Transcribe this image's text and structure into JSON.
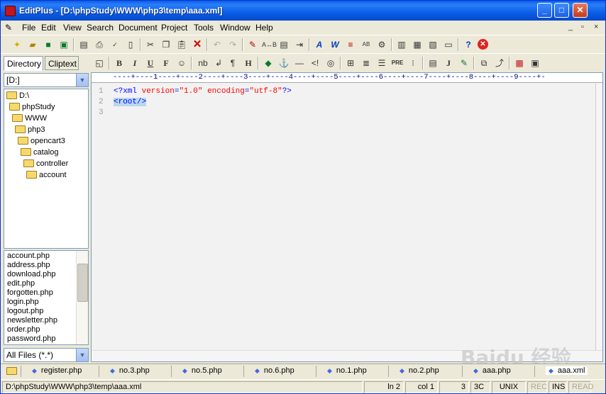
{
  "window": {
    "title": "EditPlus - [D:\\phpStudy\\WWW\\php3\\temp\\aaa.xml]",
    "minimize": "_",
    "maximize": "□",
    "close": "✕"
  },
  "menu": [
    "File",
    "Edit",
    "View",
    "Search",
    "Document",
    "Project",
    "Tools",
    "Window",
    "Help"
  ],
  "mdi_controls": [
    "_",
    "▫",
    "×"
  ],
  "left_panel": {
    "tabs": [
      "Directory",
      "Cliptext"
    ],
    "drive": "[D:]",
    "tree": [
      "D:\\",
      "phpStudy",
      "WWW",
      "php3",
      "opencart3",
      "catalog",
      "controller",
      "account"
    ],
    "files": [
      "account.php",
      "address.php",
      "download.php",
      "edit.php",
      "forgotten.php",
      "login.php",
      "logout.php",
      "newsletter.php",
      "order.php",
      "password.php"
    ],
    "filter": "All Files (*.*)"
  },
  "editor": {
    "ruler": "----+----1----+----2----+----3----+----4----+----5----+----6----+----7----+----8----+----9----+-",
    "line_numbers": [
      "1",
      "2",
      "3"
    ],
    "lines": {
      "l1_open": "<?xml ",
      "l1_attr1": "version",
      "l1_eq1": "=",
      "l1_val1": "\"1.0\"",
      "l1_sp": " ",
      "l1_attr2": "encoding",
      "l1_eq2": "=",
      "l1_val2": "\"utf-8\"",
      "l1_close": "?>",
      "l2": "<root/>"
    }
  },
  "file_tabs": [
    "register.php",
    "no.3.php",
    "no.5.php",
    "no.6.php",
    "no.1.php",
    "no.2.php",
    "aaa.php",
    "aaa.xml"
  ],
  "status": {
    "path": "D:\\phpStudy\\WWW\\php3\\temp\\aaa.xml",
    "line": "ln 2",
    "col": "col 1",
    "num": "3",
    "hex": "3C",
    "eol": "UNIX",
    "rec": "REC",
    "ins": "INS",
    "read": "READ"
  },
  "watermark": "Baidu 经验"
}
